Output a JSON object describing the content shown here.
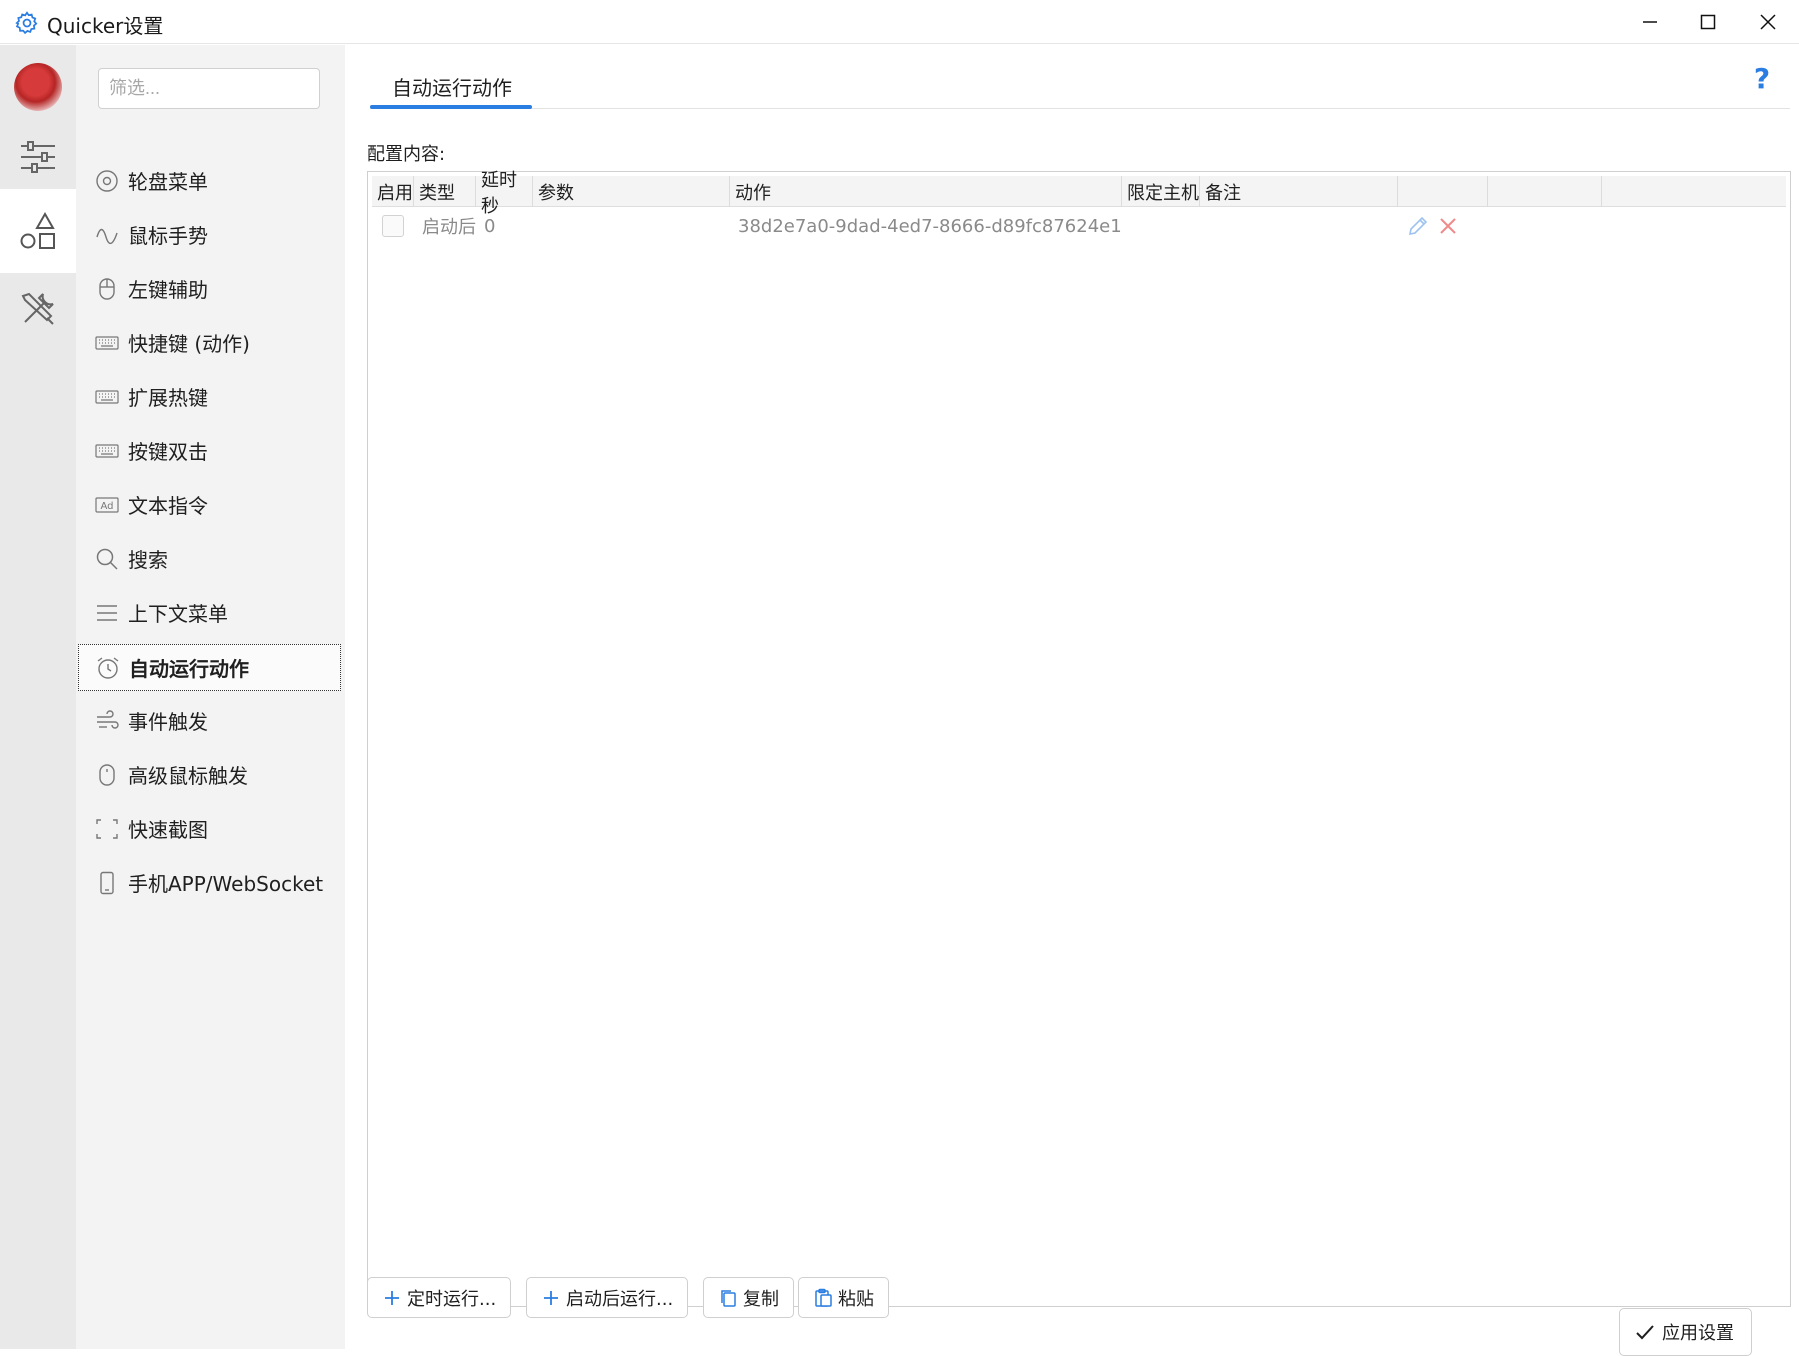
{
  "window": {
    "title": "Quicker设置",
    "controls": [
      "minimize-icon",
      "maximize-icon",
      "close-icon"
    ]
  },
  "rail": {
    "items": [
      {
        "icon": "sliders-icon"
      },
      {
        "icon": "shapes-icon",
        "active": true
      },
      {
        "icon": "tools-icon"
      }
    ]
  },
  "sidebar": {
    "filter_placeholder": "筛选...",
    "items": [
      {
        "label": "轮盘菜单",
        "icon": "disc-icon"
      },
      {
        "label": "鼠标手势",
        "icon": "wave-icon"
      },
      {
        "label": "左键辅助",
        "icon": "mouse-icon"
      },
      {
        "label": "快捷键 (动作)",
        "icon": "keyboard-icon"
      },
      {
        "label": "扩展热键",
        "icon": "keyboard-icon"
      },
      {
        "label": "按键双击",
        "icon": "keyboard-icon"
      },
      {
        "label": "文本指令",
        "icon": "ad-icon",
        "icon_text": "Ad"
      },
      {
        "label": "搜索",
        "icon": "search-icon"
      },
      {
        "label": "上下文菜单",
        "icon": "menu-icon"
      },
      {
        "label": "自动运行动作",
        "icon": "alarm-clock-icon",
        "active": true
      },
      {
        "label": "事件触发",
        "icon": "wind-icon"
      },
      {
        "label": "高级鼠标触发",
        "icon": "mouse-icon"
      },
      {
        "label": "快速截图",
        "icon": "screenshot-icon"
      },
      {
        "label": "手机APP/WebSocket",
        "icon": "phone-icon"
      }
    ]
  },
  "main": {
    "tab_label": "自动运行动作",
    "help_label": "?",
    "config_label": "配置内容:",
    "table": {
      "columns": [
        "启用",
        "类型",
        "延时秒",
        "参数",
        "动作",
        "限定主机",
        "备注",
        "",
        ""
      ],
      "rows": [
        {
          "enabled": false,
          "type": "启动后",
          "delay": "0",
          "param": "",
          "action": "38d2e7a0-9dad-4ed7-8666-d89fc87624e1",
          "host": "",
          "note": ""
        }
      ]
    },
    "buttons": {
      "add_timer": "定时运行...",
      "add_startup": "启动后运行...",
      "copy": "复制",
      "paste": "粘贴",
      "apply": "应用设置"
    }
  },
  "colors": {
    "accent": "#2a7de1",
    "delete": "#f08a8a",
    "edit": "#9cc3ef"
  }
}
